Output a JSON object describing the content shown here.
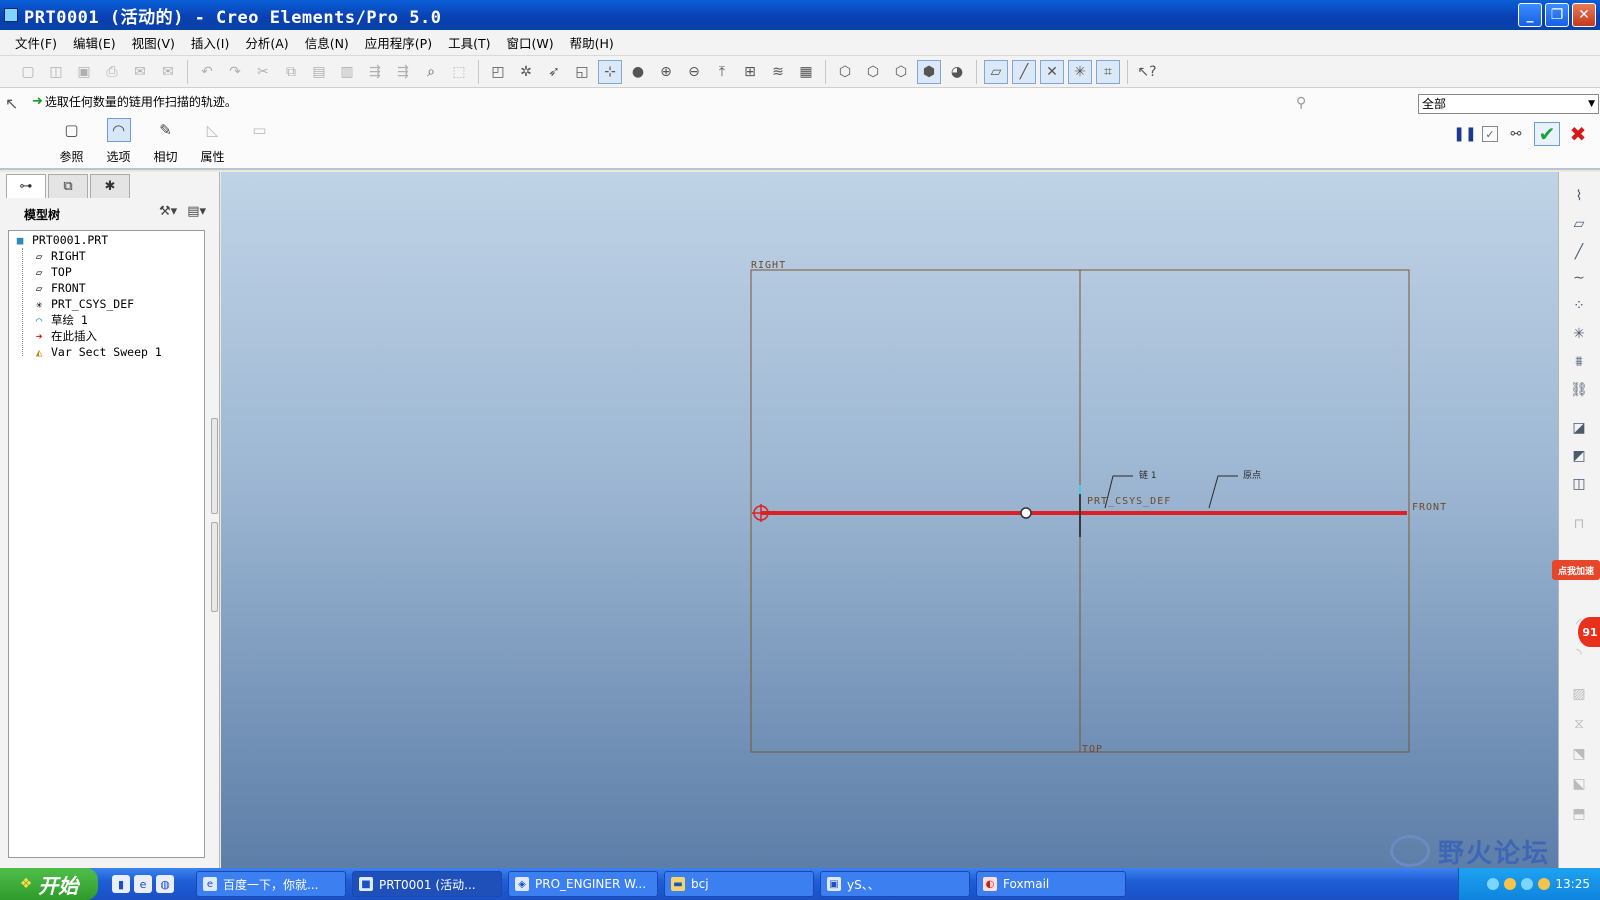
{
  "window": {
    "title": "PRT0001 (活动的) - Creo Elements/Pro 5.0",
    "minimize": "_",
    "restore": "❐",
    "close": "✕"
  },
  "menu": [
    "文件(F)",
    "编辑(E)",
    "视图(V)",
    "插入(I)",
    "分析(A)",
    "信息(N)",
    "应用程序(P)",
    "工具(T)",
    "窗口(W)",
    "帮助(H)"
  ],
  "dashboard": {
    "message": "选取任何数量的链用作扫描的轨迹。",
    "filter": "全部",
    "tabs": [
      {
        "label": "参照"
      },
      {
        "label": "选项"
      },
      {
        "label": "相切"
      },
      {
        "label": "属性"
      }
    ]
  },
  "model_tree": {
    "title": "模型树",
    "items": [
      {
        "label": "PRT0001.PRT",
        "icon": "part-icon"
      },
      {
        "label": "RIGHT",
        "icon": "datum-plane-icon"
      },
      {
        "label": "TOP",
        "icon": "datum-plane-icon"
      },
      {
        "label": "FRONT",
        "icon": "datum-plane-icon"
      },
      {
        "label": "PRT_CSYS_DEF",
        "icon": "csys-icon"
      },
      {
        "label": "草绘 1",
        "icon": "sketch-icon"
      },
      {
        "label": "在此插入",
        "icon": "insert-arrow-icon"
      },
      {
        "label": "Var Sect Sweep 1",
        "icon": "sweep-icon"
      }
    ]
  },
  "graphics": {
    "plane_labels": {
      "right": "RIGHT",
      "top": "TOP",
      "front": "FRONT"
    },
    "csys_label": "PRT_CSYS_DEF",
    "callouts": [
      "链 1",
      "原点"
    ],
    "colors": {
      "plane": "#7a5634",
      "trajectory": "#e02020",
      "background_top": "#c0d3e6",
      "background_bottom": "#5d7ea8"
    }
  },
  "right_badges": {
    "speed": "点我加速",
    "count": "91"
  },
  "watermark": "野火论坛",
  "taskbar": {
    "start": "开始",
    "tasks": [
      "百度一下，你就...",
      "PRT0001 (活动...",
      "PRO_ENGINER W...",
      "bcj",
      "yS、、",
      "Foxmail"
    ],
    "clock": "13:25"
  }
}
